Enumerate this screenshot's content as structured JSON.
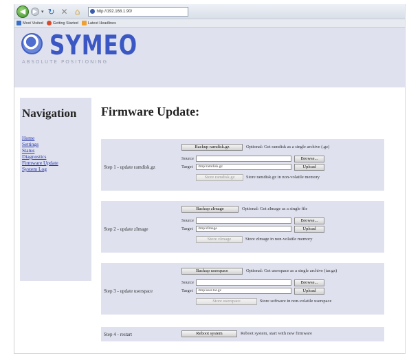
{
  "browser": {
    "back_glyph": "◀",
    "forward_glyph": "▶",
    "dropdown_glyph": "▾",
    "reload_glyph": "↻",
    "stop_glyph": "✕",
    "home_glyph": "⌂",
    "url": "http://192.168.1.90/",
    "bookmarks": [
      "Most Visited",
      "Getting Started",
      "Latest Headlines"
    ]
  },
  "header": {
    "logo_text": "SYMEO",
    "tagline": "ABSOLUTE POSITIONING"
  },
  "sidebar": {
    "title": "Navigation",
    "items": [
      "Home",
      "Settings",
      "Status",
      "Diagnostics",
      "Firmware Update",
      "System Log"
    ]
  },
  "main": {
    "title": "Firmware Update:",
    "steps": [
      {
        "label": "Step 1 - update ramdisk.gz",
        "backup_label": "Backup ramdisk.gz",
        "backup_note": "Optional: Get ramdisk as a single archive (.gz)",
        "source_label": "Source",
        "source_value": "",
        "browse_label": "Browse...",
        "target_label": "Target",
        "target_value": "/tmp/ramdisk.gz",
        "upload_label": "Upload",
        "store_label": "Store ramdisk.gz",
        "store_note": "Store ramdisk.gz in non-volatile memory"
      },
      {
        "label": "Step 2 - update zImage",
        "backup_label": "Backup zImage",
        "backup_note": "Optional: Get zImage as a single file",
        "source_label": "Source",
        "source_value": "",
        "browse_label": "Browse...",
        "target_label": "Target",
        "target_value": "/tmp/zImage",
        "upload_label": "Upload",
        "store_label": "Store zImage",
        "store_note": "Store zImage in non-volatile memory"
      },
      {
        "label": "Step 3 - update userspace",
        "backup_label": "Backup userspace",
        "backup_note": "Optional: Get userspace as a single archive (tar.gz)",
        "source_label": "Source",
        "source_value": "",
        "browse_label": "Browse...",
        "target_label": "Target",
        "target_value": "/tmp/user.tar.gz",
        "upload_label": "Upload",
        "store_label": "Store userspace",
        "store_note": "Store software in non-volatile userspace"
      }
    ],
    "restart": {
      "label": "Step 4 - restart",
      "button_label": "Reboot system",
      "note": "Reboot system, start with new firmware"
    }
  }
}
